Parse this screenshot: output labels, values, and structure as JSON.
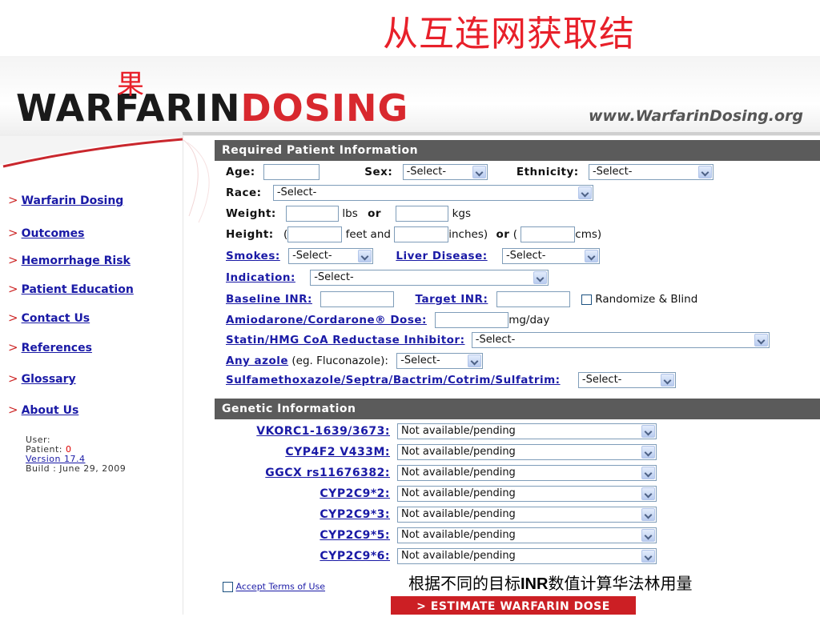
{
  "slide": {
    "title_line1": "从互连网获取结",
    "title_line2": "果",
    "caption_pre": "根据不同的目标",
    "caption_bold": "INR",
    "caption_post": "数值计算华法林用量"
  },
  "site": {
    "logo_part1": "WARFARIN",
    "logo_part2": "DOSING",
    "url": "www.WarfarinDosing.org",
    "colors": {
      "brand_red": "#d8282e",
      "header_gray": "#5b5b5b",
      "link_blue": "#1a1aa6"
    }
  },
  "nav": {
    "items": [
      {
        "label": "Warfarin Dosing"
      },
      {
        "label": "Outcomes"
      },
      {
        "label": "Hemorrhage Risk"
      },
      {
        "label": "Patient Education"
      },
      {
        "label": "Contact Us"
      },
      {
        "label": "References"
      },
      {
        "label": "Glossary"
      },
      {
        "label": "About Us"
      }
    ],
    "user_label": "User:",
    "patient_label": "Patient:",
    "patient_value": "0",
    "version": "Version 17.4",
    "build": "Build : June 29, 2009"
  },
  "required": {
    "header": "Required Patient Information",
    "age_label": "Age:",
    "sex_label": "Sex:",
    "sex_value": "-Select-",
    "ethnicity_label": "Ethnicity:",
    "ethnicity_value": "-Select-",
    "race_label": "Race:",
    "race_value": "-Select-",
    "weight_label": "Weight:",
    "lbs": "lbs",
    "or": "or",
    "kgs": "kgs",
    "height_label": "Height:",
    "open_paren": "(",
    "feet_and": "feet and",
    "inches_close": "inches)",
    "or2": "or",
    "open_paren2": "(",
    "cms_close": "cms)",
    "smokes_label": "Smokes:",
    "smokes_value": "-Select-",
    "liver_label": "Liver Disease:",
    "liver_value": "-Select-",
    "indication_label": "Indication:",
    "indication_value": "-Select-",
    "baseline_label": "Baseline INR:",
    "target_label": "Target INR:",
    "randomize_label": "Randomize & Blind",
    "amio_label": "Amiodarone/Cordarone® Dose:",
    "amio_unit": "mg/day",
    "statin_label": "Statin/HMG CoA Reductase Inhibitor:",
    "statin_value": "-Select-",
    "azole_label": "Any azole",
    "azole_note": "(eg. Fluconazole):",
    "azole_value": "-Select-",
    "sulfa_label": "Sulfamethoxazole/Septra/Bactrim/Cotrim/Sulfatrim:",
    "sulfa_value": "-Select-"
  },
  "genetic": {
    "header": "Genetic Information",
    "rows": [
      {
        "label": "VKORC1-1639/3673:",
        "value": "Not available/pending"
      },
      {
        "label": "CYP4F2 V433M:",
        "value": "Not available/pending"
      },
      {
        "label": "GGCX rs11676382:",
        "value": "Not available/pending"
      },
      {
        "label": "CYP2C9*2:",
        "value": "Not available/pending"
      },
      {
        "label": "CYP2C9*3:",
        "value": "Not available/pending"
      },
      {
        "label": "CYP2C9*5:",
        "value": "Not available/pending"
      },
      {
        "label": "CYP2C9*6:",
        "value": "Not available/pending"
      }
    ]
  },
  "footer": {
    "accept_terms": "Accept Terms of Use",
    "estimate_button": "> ESTIMATE WARFARIN DOSE"
  }
}
